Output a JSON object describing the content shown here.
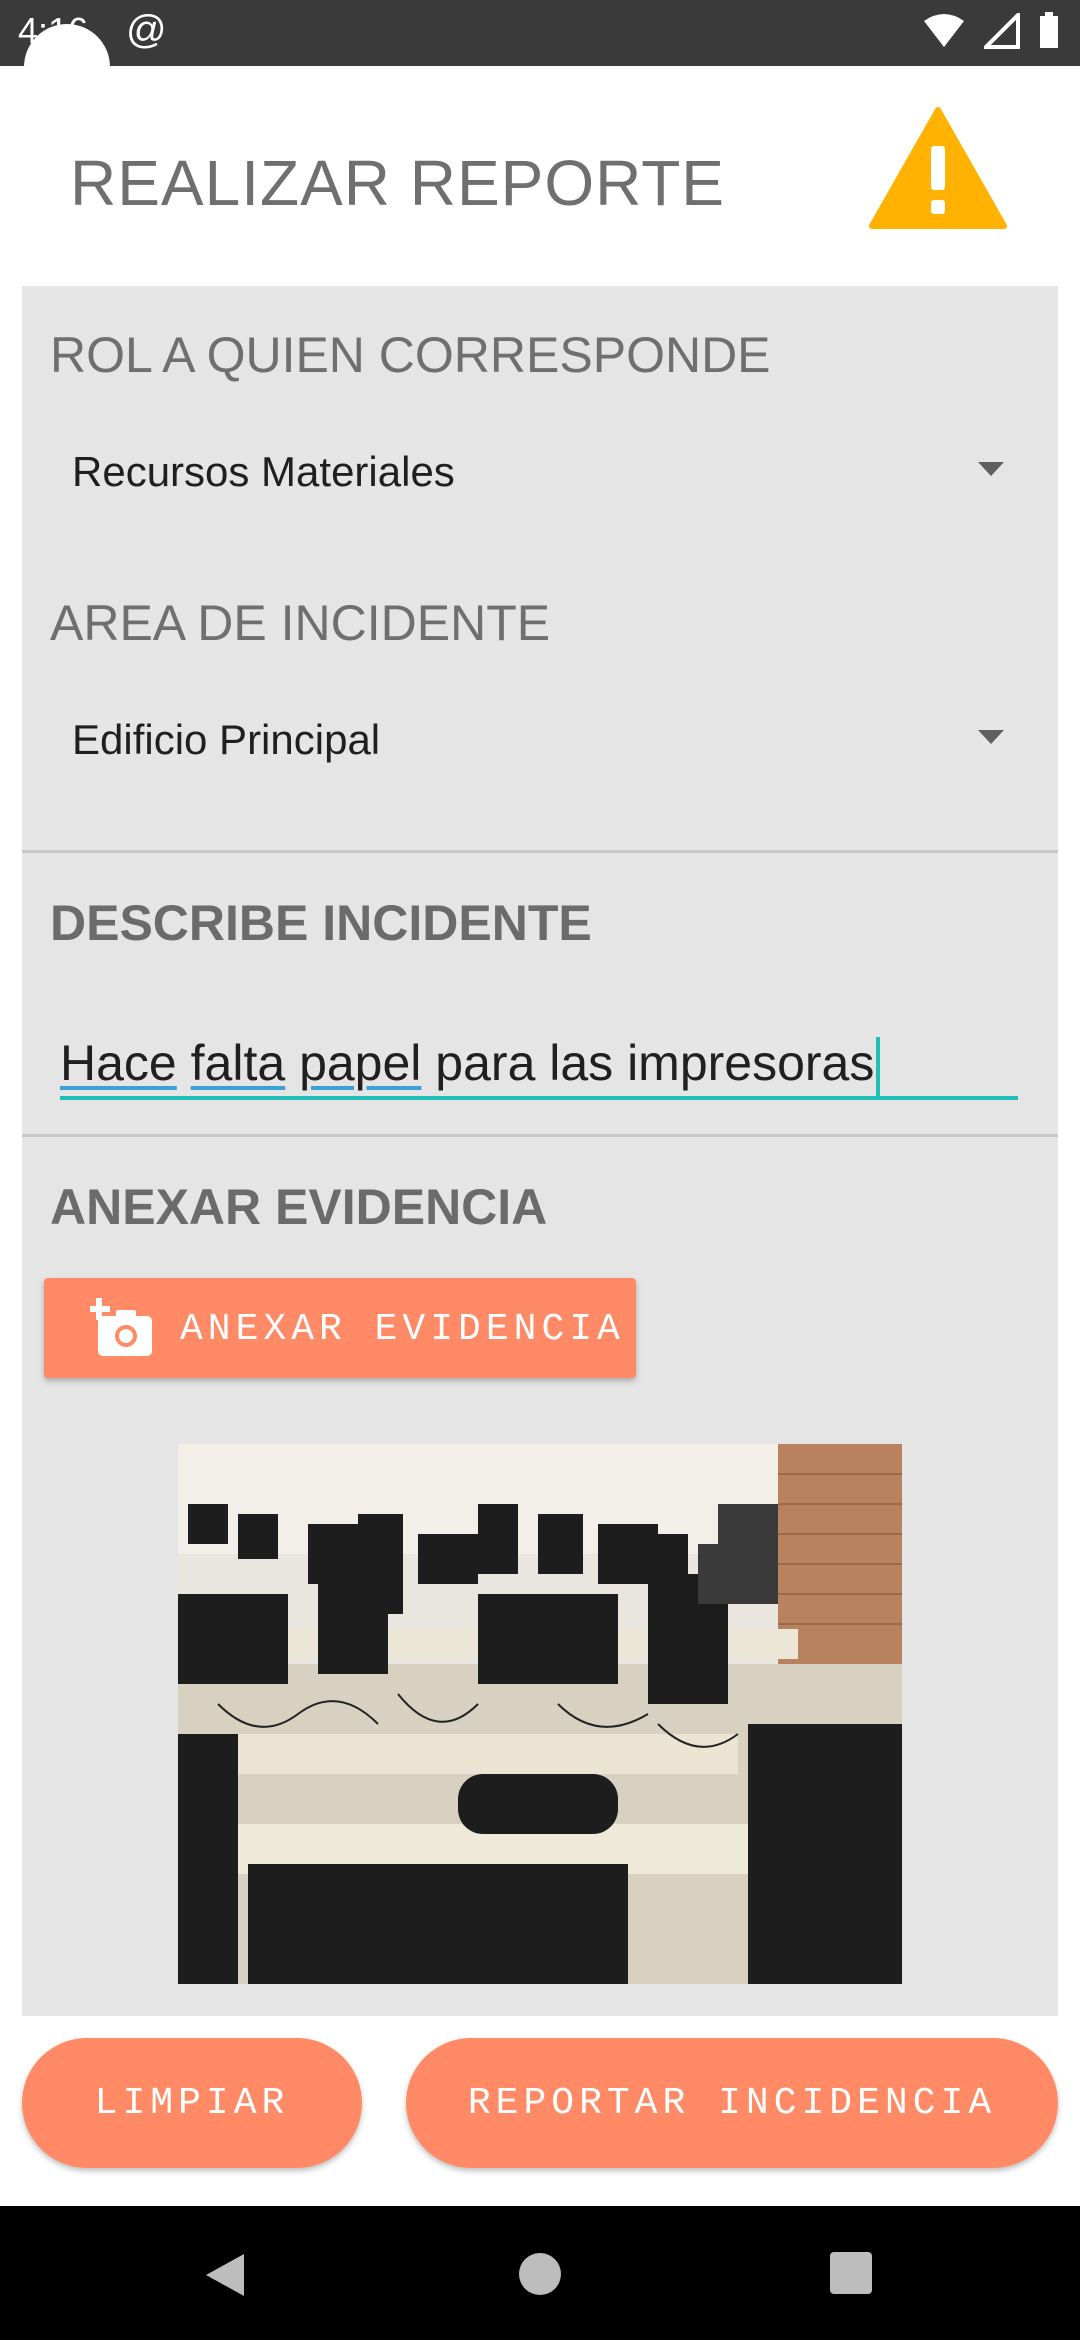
{
  "status_bar": {
    "time": "4:16",
    "at_symbol": "@",
    "icons": [
      "wifi-icon",
      "signal-icon",
      "battery-icon"
    ]
  },
  "app_bar": {
    "title": "REALIZAR REPORTE",
    "icon": "warning-icon",
    "icon_color": "#FFB300"
  },
  "form": {
    "rol": {
      "label": "ROL A QUIEN CORRESPONDE",
      "value": "Recursos Materiales"
    },
    "area": {
      "label": "AREA DE INCIDENTE",
      "value": "Edificio Principal"
    },
    "describe": {
      "label": "DESCRIBE INCIDENTE",
      "words": [
        "Hace",
        "falta",
        "papel"
      ],
      "rest": " para las impresoras"
    },
    "evidence": {
      "label": "ANEXAR EVIDENCIA",
      "button_label": "ANEXAR EVIDENCIA",
      "button_icon": "add-camera-icon"
    }
  },
  "actions": {
    "clear_label": "LIMPIAR",
    "report_label": "REPORTAR INCIDENCIA"
  },
  "colors": {
    "accent": "#FF8A65",
    "focus": "#1FBFB8",
    "panel": "#E5E5E5"
  },
  "nav_bar": {
    "icons": [
      "back-icon",
      "home-icon",
      "recents-icon"
    ]
  }
}
